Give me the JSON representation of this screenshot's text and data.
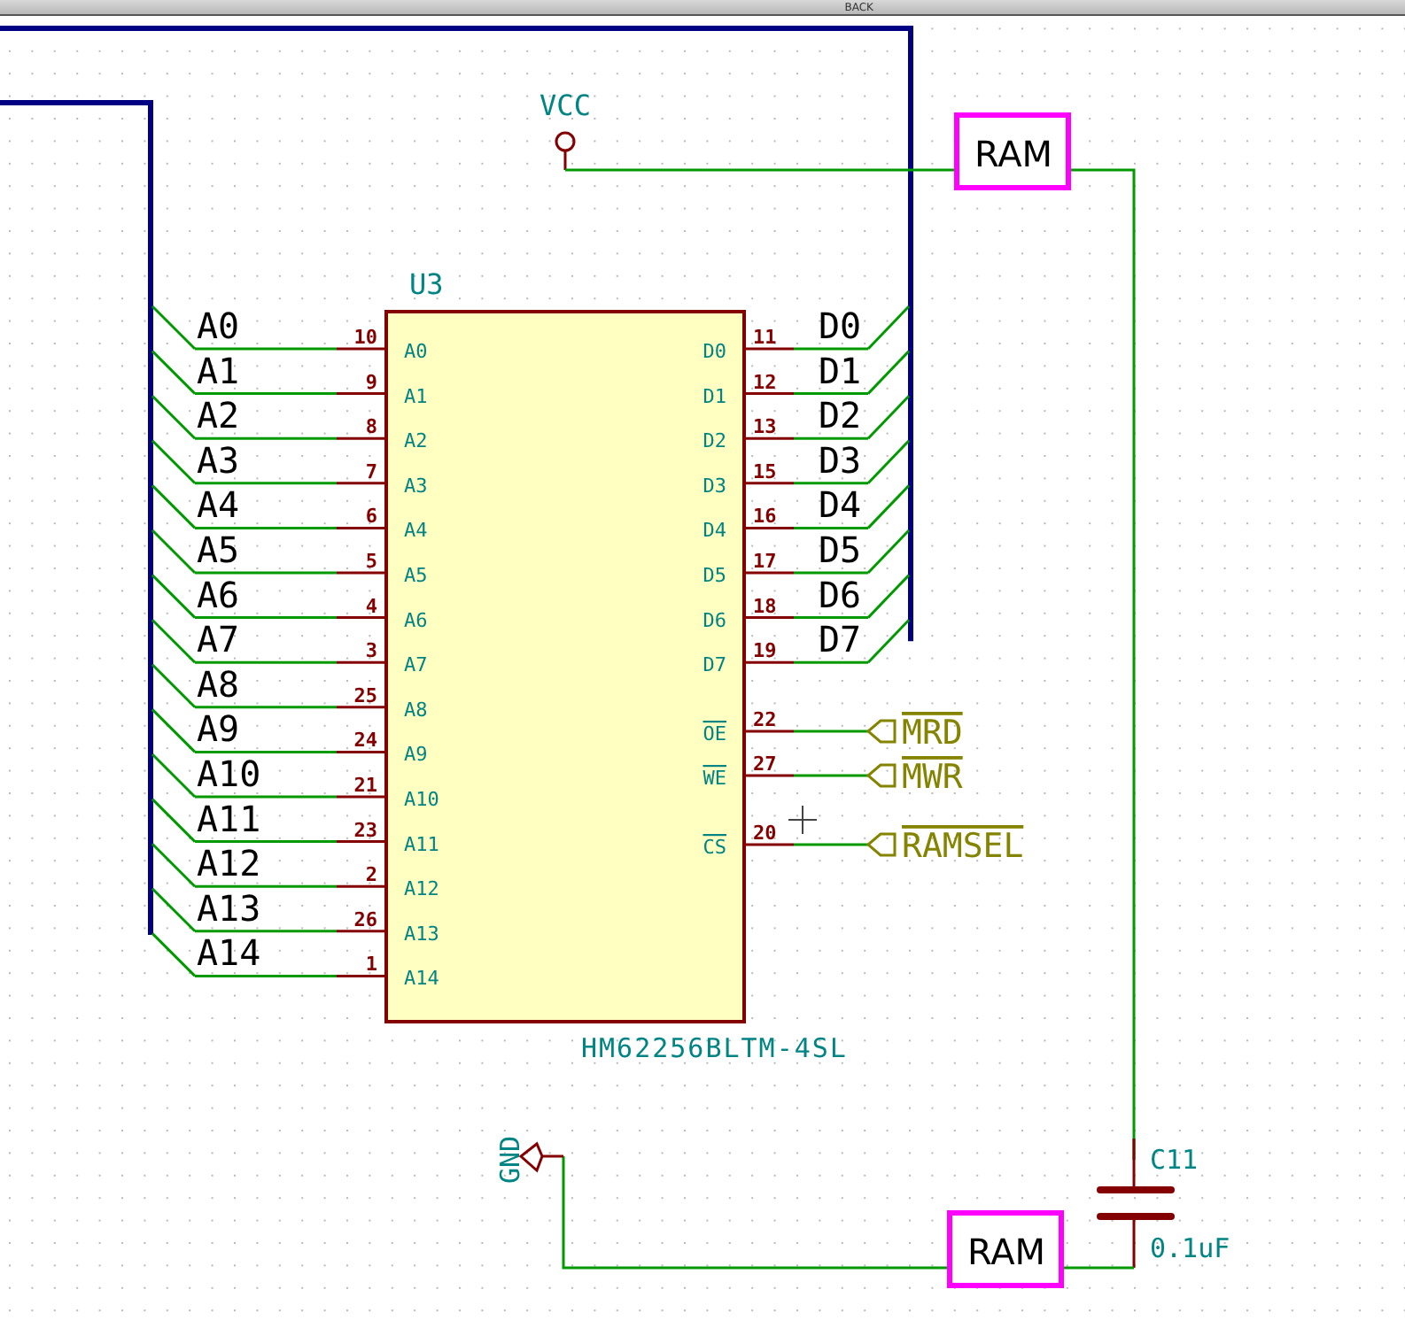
{
  "toolbar": {
    "back_label": "BACK"
  },
  "schematic": {
    "reference": "U3",
    "value": "HM62256BLTM-4SL",
    "left_pins": [
      {
        "name": "A0",
        "number": "10",
        "net": "A0"
      },
      {
        "name": "A1",
        "number": "9",
        "net": "A1"
      },
      {
        "name": "A2",
        "number": "8",
        "net": "A2"
      },
      {
        "name": "A3",
        "number": "7",
        "net": "A3"
      },
      {
        "name": "A4",
        "number": "6",
        "net": "A4"
      },
      {
        "name": "A5",
        "number": "5",
        "net": "A5"
      },
      {
        "name": "A6",
        "number": "4",
        "net": "A6"
      },
      {
        "name": "A7",
        "number": "3",
        "net": "A7"
      },
      {
        "name": "A8",
        "number": "25",
        "net": "A8"
      },
      {
        "name": "A9",
        "number": "24",
        "net": "A9"
      },
      {
        "name": "A10",
        "number": "21",
        "net": "A10"
      },
      {
        "name": "A11",
        "number": "23",
        "net": "A11"
      },
      {
        "name": "A12",
        "number": "2",
        "net": "A12"
      },
      {
        "name": "A13",
        "number": "26",
        "net": "A13"
      },
      {
        "name": "A14",
        "number": "1",
        "net": "A14"
      }
    ],
    "right_pins": [
      {
        "name": "D0",
        "number": "11",
        "net": "D0",
        "kind": "bus",
        "inverted": false
      },
      {
        "name": "D1",
        "number": "12",
        "net": "D1",
        "kind": "bus",
        "inverted": false
      },
      {
        "name": "D2",
        "number": "13",
        "net": "D2",
        "kind": "bus",
        "inverted": false
      },
      {
        "name": "D3",
        "number": "15",
        "net": "D3",
        "kind": "bus",
        "inverted": false
      },
      {
        "name": "D4",
        "number": "16",
        "net": "D4",
        "kind": "bus",
        "inverted": false
      },
      {
        "name": "D5",
        "number": "17",
        "net": "D5",
        "kind": "bus",
        "inverted": false
      },
      {
        "name": "D6",
        "number": "18",
        "net": "D6",
        "kind": "bus",
        "inverted": false
      },
      {
        "name": "D7",
        "number": "19",
        "net": "D7",
        "kind": "bus",
        "inverted": false
      },
      {
        "name": "OE",
        "number": "22",
        "net": "MRD",
        "kind": "global",
        "inverted": true
      },
      {
        "name": "WE",
        "number": "27",
        "net": "MWR",
        "kind": "global",
        "inverted": true
      },
      {
        "name": "CS",
        "number": "20",
        "net": "RAMSEL",
        "kind": "global",
        "inverted": true
      }
    ],
    "power": {
      "supply": "VCC",
      "ground": "GND"
    },
    "capacitor": {
      "reference": "C11",
      "value": "0.1uF"
    },
    "highlights": [
      "RAM",
      "RAM"
    ]
  }
}
